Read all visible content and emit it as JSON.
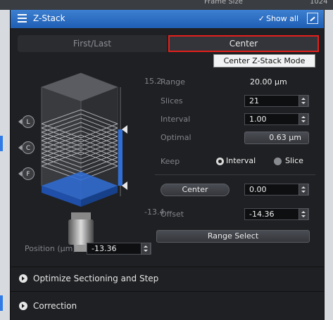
{
  "window": {
    "title": "Z-Stack",
    "show_all": "Show all",
    "check_glyph": "✓"
  },
  "background": {
    "partial_text": "Frame Size",
    "partial_number": "1024"
  },
  "tabs": [
    {
      "label": "First/Last",
      "active": false
    },
    {
      "label": "Center",
      "active": true
    }
  ],
  "tooltip": "Center Z-Stack Mode",
  "graphic": {
    "top_value": "15.2",
    "bottom_value": "-13.4",
    "buttons": [
      "L",
      "C",
      "F"
    ]
  },
  "params": {
    "range_label": "Range",
    "range_value": "20.00 µm",
    "slices_label": "Slices",
    "slices_value": "21",
    "interval_label": "Interval",
    "interval_value": "1.00",
    "optimal_label": "Optimal",
    "optimal_value": "0.63 µm",
    "keep_label": "Keep",
    "keep_options": [
      "Interval",
      "Slice"
    ],
    "keep_selected": "Interval",
    "center_button": "Center",
    "center_value": "0.00",
    "offset_label": "Offset",
    "offset_value": "-14.36",
    "range_select_button": "Range Select"
  },
  "position": {
    "label": "Position (µm)",
    "value": "-13.36"
  },
  "sections": [
    {
      "label": "Optimize Sectioning and Step"
    },
    {
      "label": "Correction"
    }
  ],
  "colors": {
    "title_bar": "#1e5fb5",
    "highlight": "#e2201b",
    "stack_blue": "#2f6fd8"
  }
}
